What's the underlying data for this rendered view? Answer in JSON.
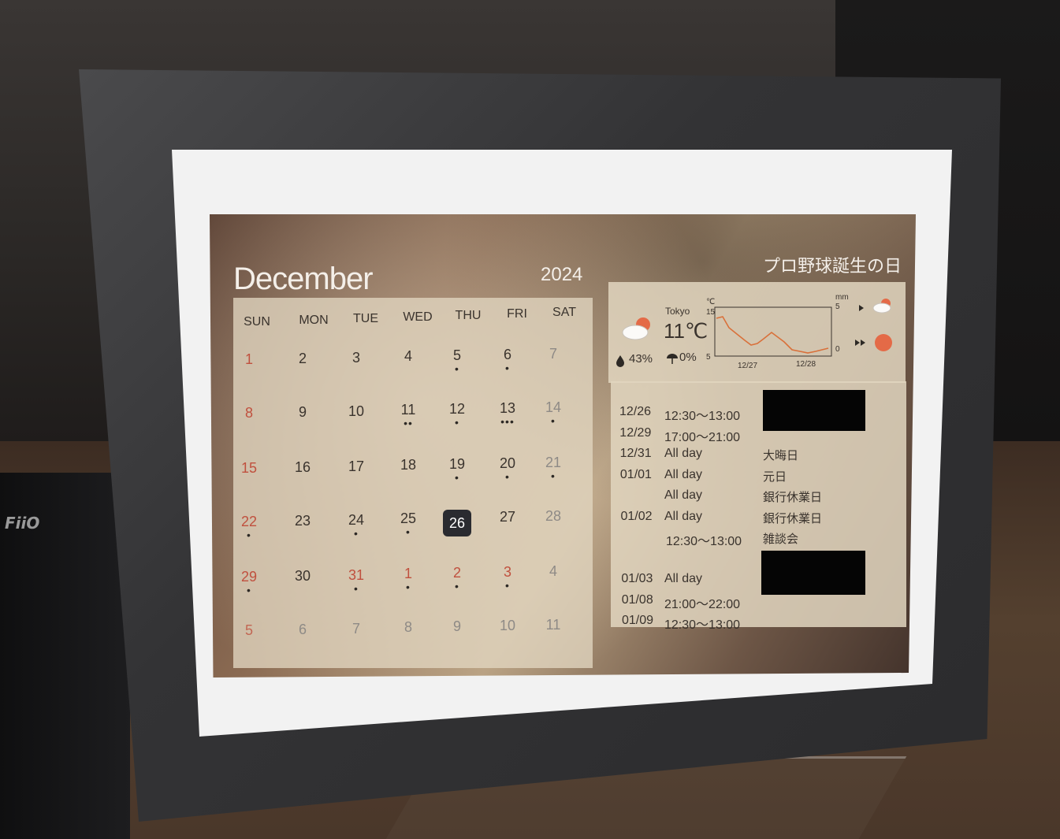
{
  "calendar": {
    "month": "December",
    "year": "2024",
    "holiday_name": "プロ野球誕生の日",
    "weekdays": [
      "SUN",
      "MON",
      "TUE",
      "WED",
      "THU",
      "FRI",
      "SAT"
    ],
    "days": [
      "1",
      "2",
      "3",
      "4",
      "5",
      "6",
      "7",
      "8",
      "9",
      "10",
      "11",
      "12",
      "13",
      "14",
      "15",
      "16",
      "17",
      "18",
      "19",
      "20",
      "21",
      "22",
      "23",
      "24",
      "25",
      "26",
      "27",
      "28",
      "29",
      "30",
      "31",
      "1",
      "2",
      "3",
      "4",
      "5",
      "6",
      "7",
      "8",
      "9",
      "10",
      "11"
    ],
    "today": "26"
  },
  "weather": {
    "city": "Tokyo",
    "temperature": "11℃",
    "humidity": "43%",
    "rain_chance": "0%",
    "chart": {
      "temp_unit": "℃",
      "rain_unit": "mm",
      "temp_max_tick": "15",
      "temp_min_tick": "5",
      "rain_max_tick": "5",
      "rain_min_tick": "0",
      "x_ticks": [
        "12/27",
        "12/28"
      ]
    },
    "icons": [
      "partly-cloudy-icon",
      "droplet-icon",
      "umbrella-icon",
      "cloud-sun-icon",
      "sun-icon"
    ]
  },
  "events": [
    {
      "date": "12/26",
      "time": "12:30〜13:00",
      "title": ""
    },
    {
      "date": "12/29",
      "time": "17:00〜21:00",
      "title": ""
    },
    {
      "date": "12/31",
      "time": "All day",
      "title": "大晦日"
    },
    {
      "date": "01/01",
      "time": "All day",
      "title": "元日"
    },
    {
      "date": "",
      "time": "All day",
      "title": "銀行休業日"
    },
    {
      "date": "01/02",
      "time": "All day",
      "title": "銀行休業日"
    },
    {
      "date": "",
      "time": "12:30〜13:00",
      "title": "雑談会"
    },
    {
      "date": "",
      "time": "",
      "title": "銀行休業日"
    },
    {
      "date": "01/03",
      "time": "All day",
      "title": ""
    },
    {
      "date": "01/08",
      "time": "21:00〜22:00",
      "title": ""
    },
    {
      "date": "01/09",
      "time": "12:30〜13:00",
      "title": ""
    }
  ],
  "colors": {
    "sunday": "#c0503e",
    "today_bg": "#2a2b30",
    "panel": "#e2d6c0",
    "temp_line": "#d9703a"
  }
}
